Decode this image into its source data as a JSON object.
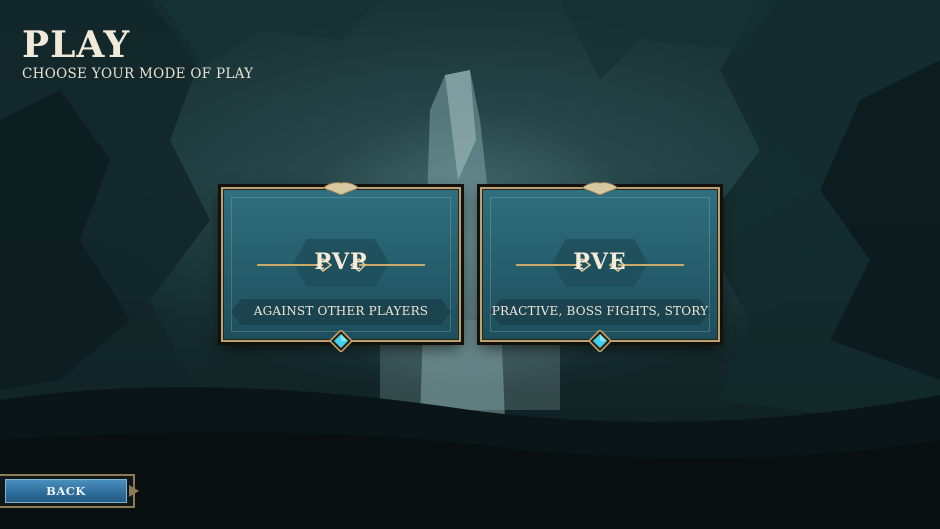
{
  "header": {
    "title": "PLAY",
    "subtitle": "CHOOSE YOUR MODE OF PLAY"
  },
  "modes": [
    {
      "name": "PVP",
      "description": "AGAINST OTHER PLAYERS"
    },
    {
      "name": "PVE",
      "description": "PRACTIVE, BOSS FIGHTS, STORY"
    }
  ],
  "back_button": {
    "label": "BACK"
  },
  "colors": {
    "gold_trim": "#b9a274",
    "card_teal": "#27606f",
    "gem_cyan": "#3fd2f0",
    "back_blue": "#2f6f9d",
    "title_text": "#f1ead8"
  },
  "icons": [
    "crest-ornament-icon",
    "diamond-gem-icon",
    "flourish-icon"
  ]
}
